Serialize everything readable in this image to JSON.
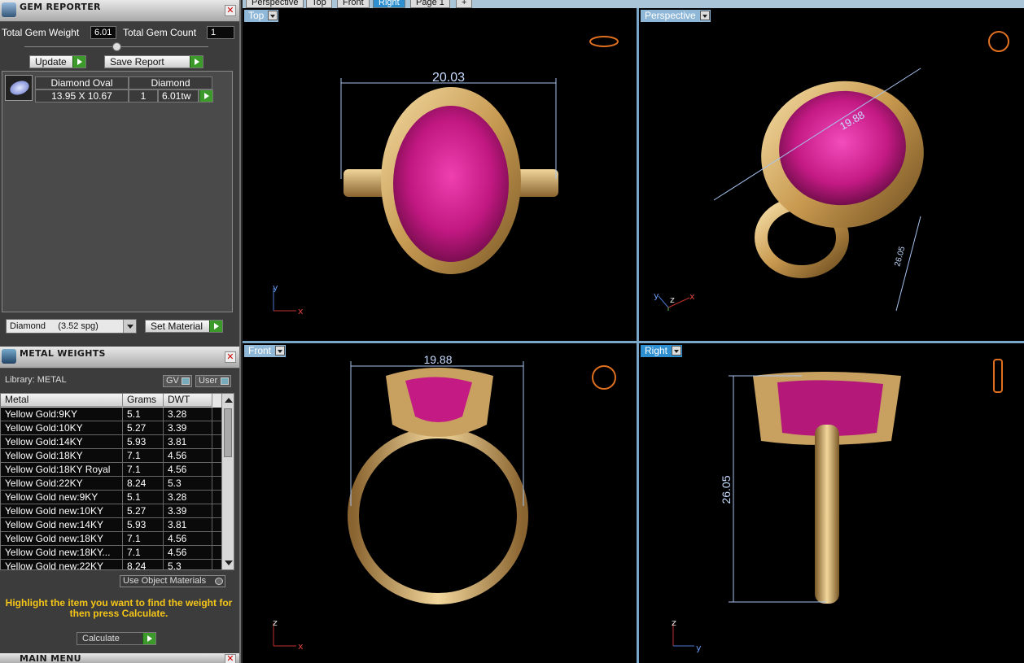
{
  "tabs": [
    "Perspective",
    "Top",
    "Front",
    "Right",
    "Page 1",
    "+"
  ],
  "active_tab": "Right",
  "gem_reporter": {
    "title": "GEM REPORTER",
    "total_gem_weight_label": "Total Gem Weight",
    "total_gem_weight": "6.01",
    "total_gem_count_label": "Total Gem Count",
    "total_gem_count": "1",
    "update_label": "Update",
    "save_report_label": "Save Report",
    "gem": {
      "name": "Diamond Oval",
      "material": "Diamond",
      "size": "13.95 X 10.67",
      "count": "1",
      "weight": "6.01tw"
    },
    "material_select": "Diamond     (3.52 spg)",
    "set_material_label": "Set Material"
  },
  "metal_weights": {
    "title": "METAL WEIGHTS",
    "library_label": "Library: METAL",
    "gv_label": "GV",
    "user_label": "User",
    "columns": [
      "Metal",
      "Grams",
      "DWT"
    ],
    "rows": [
      [
        "Yellow Gold:9KY",
        "5.1",
        "3.28"
      ],
      [
        "Yellow Gold:10KY",
        "5.27",
        "3.39"
      ],
      [
        "Yellow Gold:14KY",
        "5.93",
        "3.81"
      ],
      [
        "Yellow Gold:18KY",
        "7.1",
        "4.56"
      ],
      [
        "Yellow Gold:18KY Royal",
        "7.1",
        "4.56"
      ],
      [
        "Yellow Gold:22KY",
        "8.24",
        "5.3"
      ],
      [
        "Yellow Gold new:9KY",
        "5.1",
        "3.28"
      ],
      [
        "Yellow Gold new:10KY",
        "5.27",
        "3.39"
      ],
      [
        "Yellow Gold new:14KY",
        "5.93",
        "3.81"
      ],
      [
        "Yellow Gold new:18KY",
        "7.1",
        "4.56"
      ],
      [
        "Yellow Gold new:18KY...",
        "7.1",
        "4.56"
      ],
      [
        "Yellow Gold new:22KY",
        "8.24",
        "5.3"
      ]
    ],
    "use_object_materials_label": "Use Object Materials",
    "hint": "Highlight the item you want to find the weight for then press Calculate.",
    "calculate_label": "Calculate"
  },
  "main_menu_title": "MAIN MENU",
  "viewports": {
    "top": {
      "label": "Top",
      "dimension": "20.03",
      "axis_v": "y",
      "axis_h": "x"
    },
    "perspective": {
      "label": "Perspective",
      "dimension": "19.88",
      "dimension2": "26.05",
      "axis_a": "y",
      "axis_b": "z",
      "axis_c": "x"
    },
    "front": {
      "label": "Front",
      "dimension": "19.88",
      "axis_v": "z",
      "axis_h": "x"
    },
    "right": {
      "label": "Right",
      "dimension": "26.05",
      "axis_v": "z",
      "axis_h": "y"
    }
  },
  "colors": {
    "gold": "#d9b46e",
    "gem": "#d0208a",
    "accent": "#2e8fd0",
    "hint": "#f5c518"
  }
}
